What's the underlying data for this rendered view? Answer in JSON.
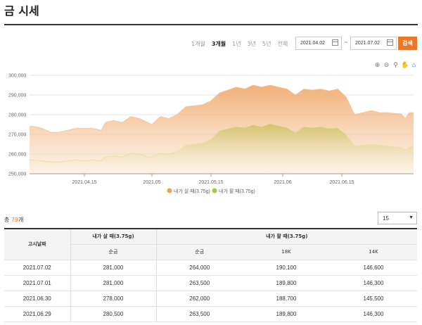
{
  "title": "금 시세",
  "periods": [
    {
      "label": "1개월",
      "active": false
    },
    {
      "label": "3개월",
      "active": true
    },
    {
      "label": "1년",
      "active": false
    },
    {
      "label": "3년",
      "active": false
    },
    {
      "label": "5년",
      "active": false
    },
    {
      "label": "전체",
      "active": false
    }
  ],
  "date_range": {
    "start": "2021.04.02",
    "separator": "~",
    "end": "2021.07.02"
  },
  "search_label": "검색",
  "chart_tools": [
    "zoom-in-icon",
    "zoom-out-icon",
    "search-icon",
    "pan-hand-icon",
    "home-icon"
  ],
  "chart_data": {
    "type": "area",
    "x_ticks": [
      "2021.04.15",
      "2021.05",
      "2021.05.15",
      "2021.06",
      "2021.06.15"
    ],
    "y_ticks": [
      "300,000",
      "290,000",
      "280,000",
      "270,000",
      "260,000",
      "250,000"
    ],
    "ylim": [
      250000,
      300000
    ],
    "xlim": [
      "2021-04-02",
      "2021-07-02"
    ],
    "grid": true,
    "legend_position": "bottom",
    "series": [
      {
        "name": "내가 살 때(3.75g)",
        "color": "#f0a15e",
        "points": [
          [
            "2021-04-02",
            274000
          ],
          [
            "2021-04-03",
            274000
          ],
          [
            "2021-04-05",
            273000
          ],
          [
            "2021-04-07",
            271000
          ],
          [
            "2021-04-09",
            271000
          ],
          [
            "2021-04-11",
            272000
          ],
          [
            "2021-04-13",
            273000
          ],
          [
            "2021-04-15",
            273000
          ],
          [
            "2021-04-17",
            273000
          ],
          [
            "2021-04-19",
            272000
          ],
          [
            "2021-04-20",
            276000
          ],
          [
            "2021-04-22",
            277000
          ],
          [
            "2021-04-24",
            276000
          ],
          [
            "2021-04-26",
            279000
          ],
          [
            "2021-04-28",
            278000
          ],
          [
            "2021-04-30",
            276000
          ],
          [
            "2021-05-01",
            275000
          ],
          [
            "2021-05-03",
            279000
          ],
          [
            "2021-05-05",
            278000
          ],
          [
            "2021-05-07",
            280000
          ],
          [
            "2021-05-09",
            284000
          ],
          [
            "2021-05-11",
            284500
          ],
          [
            "2021-05-13",
            285000
          ],
          [
            "2021-05-15",
            287000
          ],
          [
            "2021-05-17",
            291000
          ],
          [
            "2021-05-19",
            292500
          ],
          [
            "2021-05-21",
            294000
          ],
          [
            "2021-05-23",
            293000
          ],
          [
            "2021-05-25",
            295000
          ],
          [
            "2021-05-27",
            294000
          ],
          [
            "2021-05-29",
            295000
          ],
          [
            "2021-05-31",
            294000
          ],
          [
            "2021-06-02",
            293000
          ],
          [
            "2021-06-04",
            290000
          ],
          [
            "2021-06-06",
            293000
          ],
          [
            "2021-06-08",
            292500
          ],
          [
            "2021-06-10",
            293000
          ],
          [
            "2021-06-12",
            292000
          ],
          [
            "2021-06-14",
            293000
          ],
          [
            "2021-06-16",
            289000
          ],
          [
            "2021-06-18",
            280000
          ],
          [
            "2021-06-20",
            281000
          ],
          [
            "2021-06-22",
            282000
          ],
          [
            "2021-06-24",
            281000
          ],
          [
            "2021-06-26",
            281000
          ],
          [
            "2021-06-28",
            280500
          ],
          [
            "2021-06-29",
            280500
          ],
          [
            "2021-06-30",
            278000
          ],
          [
            "2021-07-01",
            281000
          ],
          [
            "2021-07-02",
            281000
          ]
        ]
      },
      {
        "name": "내가 팔 때(3.75g)",
        "color": "#c8be5a",
        "points": [
          [
            "2021-04-02",
            257000
          ],
          [
            "2021-04-03",
            257000
          ],
          [
            "2021-04-05",
            256500
          ],
          [
            "2021-04-07",
            256000
          ],
          [
            "2021-04-09",
            256000
          ],
          [
            "2021-04-11",
            256500
          ],
          [
            "2021-04-13",
            257000
          ],
          [
            "2021-04-15",
            256500
          ],
          [
            "2021-04-17",
            257000
          ],
          [
            "2021-04-19",
            256500
          ],
          [
            "2021-04-20",
            258500
          ],
          [
            "2021-04-22",
            259000
          ],
          [
            "2021-04-24",
            258500
          ],
          [
            "2021-04-26",
            260500
          ],
          [
            "2021-04-28",
            260000
          ],
          [
            "2021-04-30",
            258500
          ],
          [
            "2021-05-01",
            258500
          ],
          [
            "2021-05-03",
            260500
          ],
          [
            "2021-05-05",
            260000
          ],
          [
            "2021-05-07",
            261000
          ],
          [
            "2021-05-09",
            264500
          ],
          [
            "2021-05-11",
            265000
          ],
          [
            "2021-05-13",
            265500
          ],
          [
            "2021-05-15",
            267500
          ],
          [
            "2021-05-17",
            272000
          ],
          [
            "2021-05-19",
            273000
          ],
          [
            "2021-05-21",
            274000
          ],
          [
            "2021-05-23",
            273500
          ],
          [
            "2021-05-25",
            275000
          ],
          [
            "2021-05-27",
            274000
          ],
          [
            "2021-05-29",
            275500
          ],
          [
            "2021-05-31",
            274500
          ],
          [
            "2021-06-02",
            273500
          ],
          [
            "2021-06-04",
            271000
          ],
          [
            "2021-06-06",
            274000
          ],
          [
            "2021-06-08",
            273500
          ],
          [
            "2021-06-10",
            274000
          ],
          [
            "2021-06-12",
            273000
          ],
          [
            "2021-06-14",
            273500
          ],
          [
            "2021-06-16",
            270000
          ],
          [
            "2021-06-18",
            264000
          ],
          [
            "2021-06-20",
            264500
          ],
          [
            "2021-06-22",
            265000
          ],
          [
            "2021-06-24",
            264500
          ],
          [
            "2021-06-26",
            264000
          ],
          [
            "2021-06-28",
            263500
          ],
          [
            "2021-06-29",
            263500
          ],
          [
            "2021-06-30",
            262000
          ],
          [
            "2021-07-01",
            263500
          ],
          [
            "2021-07-02",
            264000
          ]
        ]
      }
    ]
  },
  "list": {
    "count_prefix": "총 ",
    "count": "79",
    "count_suffix": "개",
    "page_size": "15"
  },
  "table": {
    "head": {
      "date": "고시날짜",
      "buy_group": "내가 살 때(3.75g)",
      "sell_group": "내가 팔 때(3.75g)",
      "buy_pure": "순금",
      "sell_pure": "순금",
      "sell_18k": "18K",
      "sell_14k": "14K"
    },
    "rows": [
      {
        "date": "2021.07.02",
        "buy": "281,000",
        "sell_pure": "264,000",
        "k18": "190,100",
        "k14": "146,600"
      },
      {
        "date": "2021.07.01",
        "buy": "281,000",
        "sell_pure": "263,500",
        "k18": "189,800",
        "k14": "146,300"
      },
      {
        "date": "2021.06.30",
        "buy": "278,000",
        "sell_pure": "262,000",
        "k18": "188,700",
        "k14": "145,500"
      },
      {
        "date": "2021.06.29",
        "buy": "280,500",
        "sell_pure": "263,500",
        "k18": "189,800",
        "k14": "146,300"
      }
    ]
  }
}
